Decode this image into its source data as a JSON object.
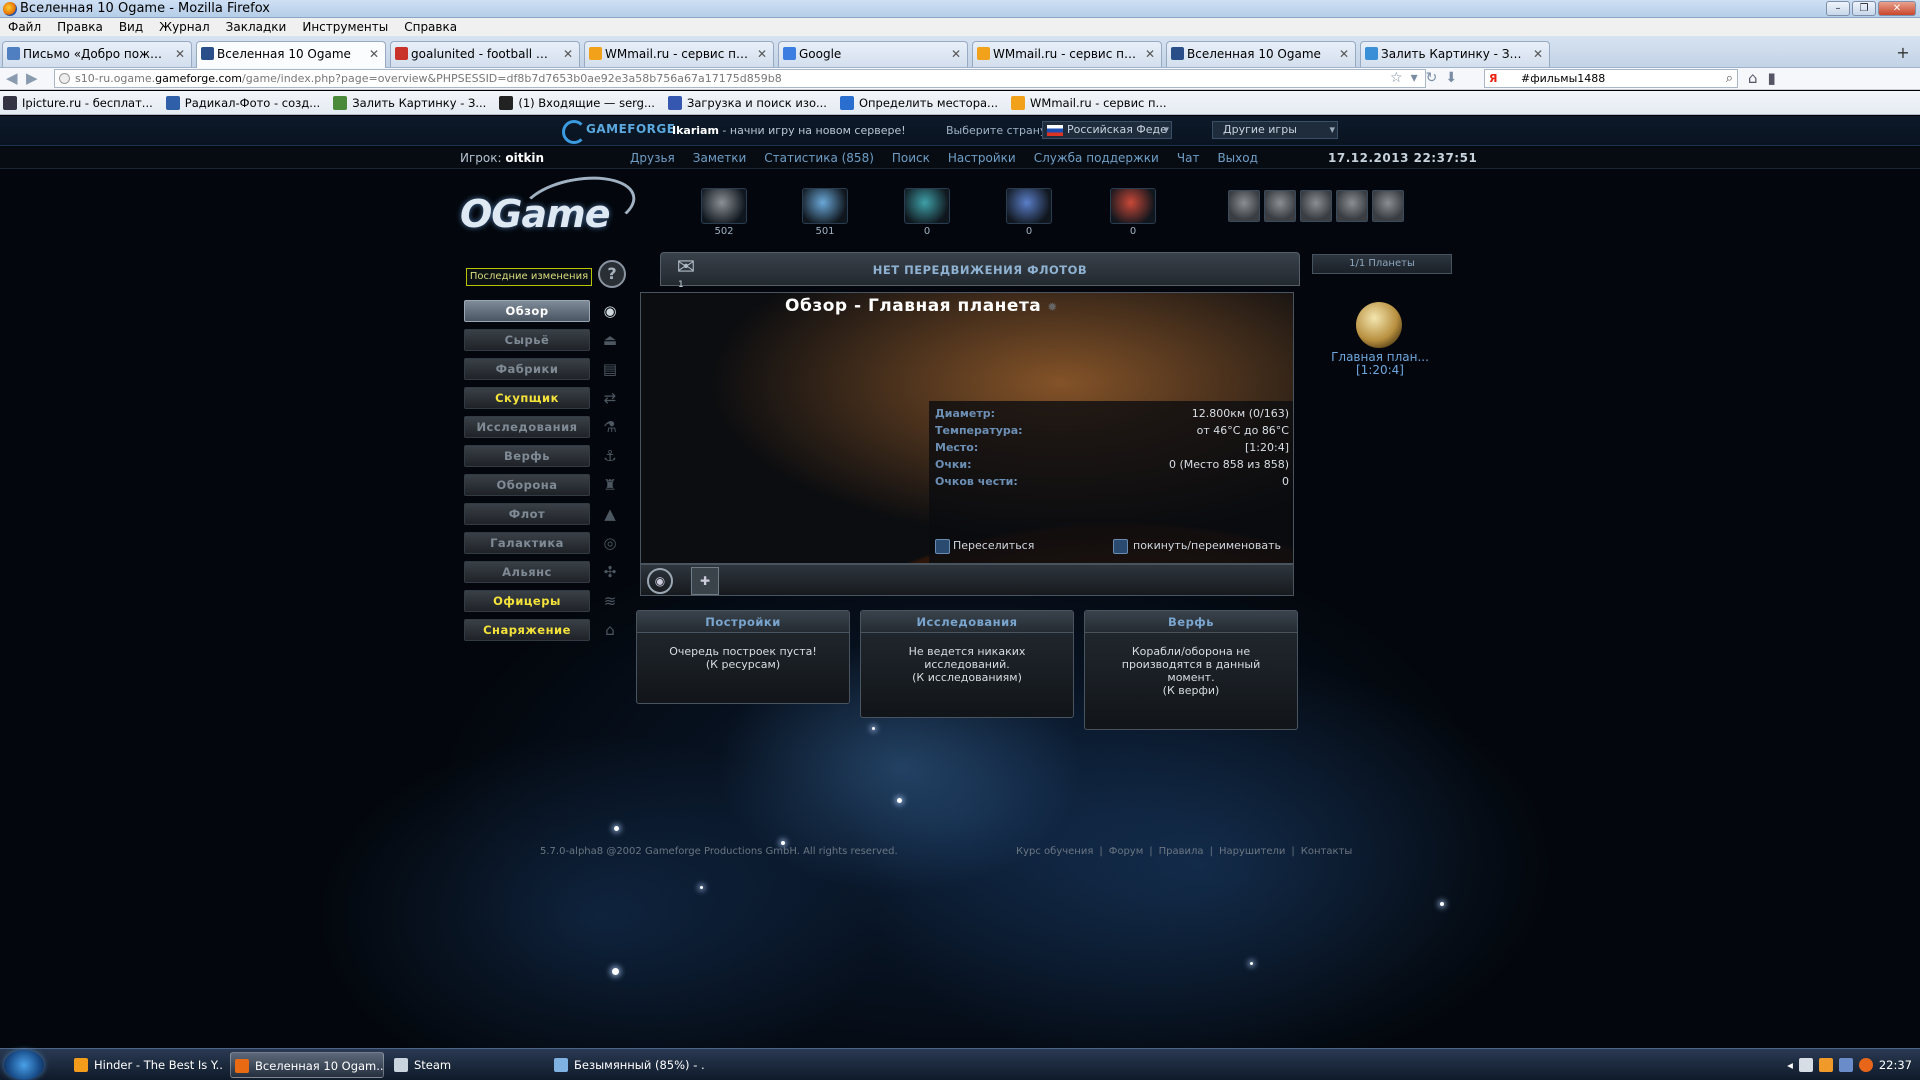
{
  "window": {
    "title": "Вселенная 10 Ogame - Mozilla Firefox"
  },
  "menu": [
    "Файл",
    "Правка",
    "Вид",
    "Журнал",
    "Закладки",
    "Инструменты",
    "Справка"
  ],
  "tabs": [
    {
      "label": "Письмо «Добро пожаловать в ОГей...",
      "active": false
    },
    {
      "label": "Вселенная 10 Ogame",
      "active": true
    },
    {
      "label": "goalunited - football manager of a ne...",
      "active": false
    },
    {
      "label": "WMmail.ru - сервис почтовых рассы...",
      "active": false
    },
    {
      "label": "Google",
      "active": false
    },
    {
      "label": "WMmail.ru - сервис почтовых рассы...",
      "active": false
    },
    {
      "label": "Вселенная 10 Ogame",
      "active": false
    },
    {
      "label": "Залить Картинку - Загрузить фото ...",
      "active": false
    }
  ],
  "url": {
    "prefix": "s10-ru.ogame.",
    "domain": "gameforge.com",
    "suffix": "/game/index.php?page=overview&PHPSESSID=df8b7d7653b0ae92e3a58b756a67a17175d859b8"
  },
  "search": {
    "value": "#фильмы1488"
  },
  "bookmarks": [
    "Ipicture.ru - бесплат...",
    "Радикал-Фото - созд...",
    "Залить Картинку - З...",
    "(1) Входящие — serg...",
    "Загрузка и поиск изо...",
    "Определить местора...",
    "WMmail.ru - сервис п..."
  ],
  "gf": {
    "logo": "GAMEFORGE",
    "promo_bold": "Ikariam",
    "promo_text": " - начни игру на новом сервере!",
    "country_label": "Выберите страну:",
    "country_value": "Российская Феде",
    "other_games": "Другие игры"
  },
  "topnav": {
    "player_label": "Игрок:",
    "player_name": "oitkin",
    "links": [
      "Друзья",
      "Заметки",
      "Статистика (858)",
      "Поиск",
      "Настройки",
      "Служба поддержки",
      "Чат",
      "Выход"
    ],
    "datetime": "17.12.2013 22:37:51"
  },
  "logo": "OGame",
  "resources": [
    {
      "name": "metal",
      "value": "502",
      "color": "#8b9097"
    },
    {
      "name": "crystal",
      "value": "501",
      "color": "#6aa8d8"
    },
    {
      "name": "deuterium",
      "value": "0",
      "color": "#3fa0a8"
    },
    {
      "name": "energy",
      "value": "0",
      "color": "#5a7ec8"
    },
    {
      "name": "dark-matter",
      "value": "0",
      "color": "#c84838"
    }
  ],
  "officers_count": 5,
  "sidebar": {
    "last_changes": "Последние изменения",
    "items": [
      {
        "label": "Обзор",
        "state": "on"
      },
      {
        "label": "Сырьё",
        "state": ""
      },
      {
        "label": "Фабрики",
        "state": ""
      },
      {
        "label": "Скупщик",
        "state": "y"
      },
      {
        "label": "Исследования",
        "state": ""
      },
      {
        "label": "Верфь",
        "state": ""
      },
      {
        "label": "Оборона",
        "state": ""
      },
      {
        "label": "Флот",
        "state": ""
      },
      {
        "label": "Галактика",
        "state": ""
      },
      {
        "label": "Альянс",
        "state": ""
      },
      {
        "label": "Офицеры",
        "state": "y"
      },
      {
        "label": "Снаряжение",
        "state": "y"
      }
    ]
  },
  "fleet": {
    "status": "НЕТ ПЕРЕДВИЖЕНИЯ ФЛОТОВ",
    "messages": "1"
  },
  "planets": {
    "count": "1/1 Планеты",
    "name": "Главная план...",
    "coords": "[1:20:4]"
  },
  "overview": {
    "title": "Обзор - Главная планета",
    "rows": [
      {
        "k": "Диаметр:",
        "v": "12.800км (0/163)"
      },
      {
        "k": "Температура:",
        "v": "от 46°C до 86°C"
      },
      {
        "k": "Место:",
        "v": "[1:20:4]"
      },
      {
        "k": "Очки:",
        "v": "0 (Место 858 из 858)"
      },
      {
        "k": "Очков чести:",
        "v": "0"
      }
    ],
    "relocate": "Переселиться",
    "abandon": "покинуть/переименовать"
  },
  "queues": [
    {
      "title": "Постройки",
      "lines": [
        "Очередь построек пуста!",
        "(К ресурсам)"
      ]
    },
    {
      "title": "Исследования",
      "lines": [
        "Не ведется никаких",
        "исследований.",
        "(К исследованиям)"
      ]
    },
    {
      "title": "Верфь",
      "lines": [
        "Корабли/оборона не",
        "производятся в данный",
        "момент.",
        "(К верфи)"
      ]
    }
  ],
  "footer": {
    "copyright": "5.7.0-alpha8  @2002 Gameforge Productions GmbH. All rights reserved.",
    "links": [
      "Курс обучения",
      "Форум",
      "Правила",
      "Нарушители",
      "Контакты"
    ]
  },
  "taskbar": {
    "items": [
      {
        "label": "Hinder - The Best Is Y...",
        "active": false,
        "color": "#f39b1a"
      },
      {
        "label": "Вселенная 10 Ogam...",
        "active": true,
        "color": "#e86a12"
      },
      {
        "label": "Steam",
        "active": false,
        "color": "#c9d4de"
      },
      {
        "label": "Безымянный (85%) - ...",
        "active": false,
        "color": "#7fb2e0"
      }
    ],
    "clock": "22:37"
  }
}
